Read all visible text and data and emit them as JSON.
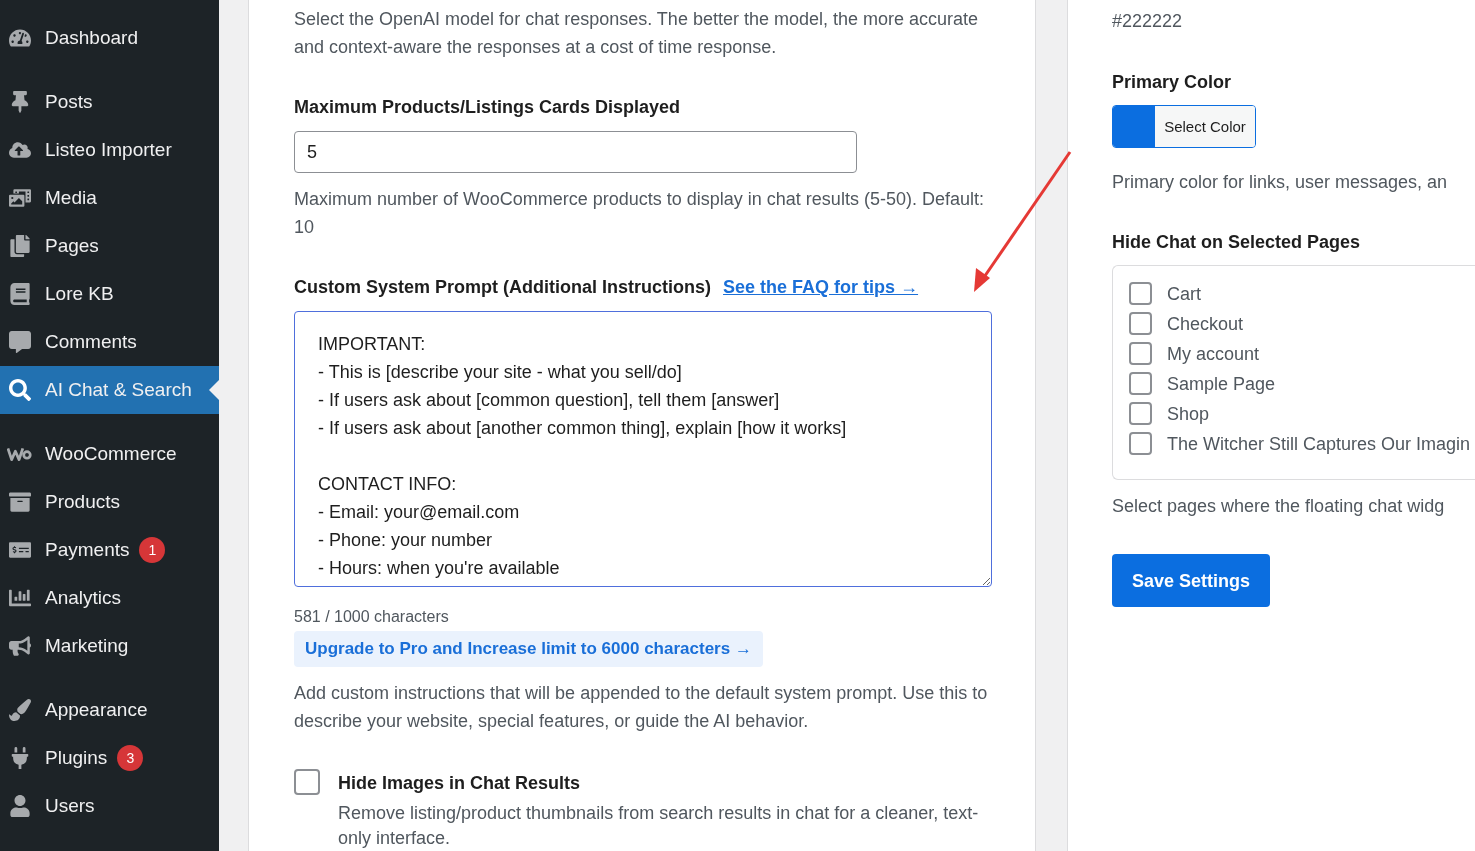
{
  "sidebar": {
    "groups": [
      [
        {
          "label": "Dashboard",
          "selected": false
        }
      ],
      [
        {
          "label": "Posts",
          "selected": false
        },
        {
          "label": "Listeo Importer",
          "selected": false
        },
        {
          "label": "Media",
          "selected": false
        },
        {
          "label": "Pages",
          "selected": false
        },
        {
          "label": "Lore KB",
          "selected": false
        },
        {
          "label": "Comments",
          "selected": false
        },
        {
          "label": "AI Chat & Search",
          "selected": true
        }
      ],
      [
        {
          "label": "WooCommerce",
          "selected": false
        },
        {
          "label": "Products",
          "selected": false
        },
        {
          "label": "Payments",
          "selected": false,
          "badge": "1"
        },
        {
          "label": "Analytics",
          "selected": false
        },
        {
          "label": "Marketing",
          "selected": false
        }
      ],
      [
        {
          "label": "Appearance",
          "selected": false
        },
        {
          "label": "Plugins",
          "selected": false,
          "badge": "3"
        },
        {
          "label": "Users",
          "selected": false
        }
      ]
    ]
  },
  "main": {
    "model_description": "Select the OpenAI model for chat responses. The better the model, the more accurate and context-aware the responses at a cost of time response.",
    "max_cards": {
      "label": "Maximum Products/Listings Cards Displayed",
      "value": "5",
      "help": "Maximum number of WooCommerce products to display in chat results (5-50). Default: 10"
    },
    "custom_prompt": {
      "label": "Custom System Prompt (Additional Instructions)",
      "link": "See the FAQ for tips →",
      "value": "IMPORTANT:\n- This is [describe your site - what you sell/do]\n- If users ask about [common question], tell them [answer]\n- If users ask about [another common thing], explain [how it works]\n\nCONTACT INFO:\n- Email: your@email.com\n- Phone: your number\n- Hours: when you're available",
      "counter": "581 / 1000 characters",
      "upgrade": "Upgrade to Pro and Increase limit to 6000 characters →",
      "help": "Add custom instructions that will be appended to the default system prompt. Use this to describe your website, special features, or guide the AI behavior."
    },
    "hide_images": {
      "label": "Hide Images in Chat Results",
      "checked": false,
      "help": "Remove listing/product thumbnails from search results in chat for a cleaner, text-only interface."
    }
  },
  "side": {
    "color_value": "#222222",
    "primary_color": {
      "label": "Primary Color",
      "color": "#0b6ee0",
      "button": "Select Color",
      "help": "Primary color for links, user messages, an"
    },
    "hide_chat": {
      "label": "Hide Chat on Selected Pages",
      "pages": [
        {
          "label": "Cart",
          "checked": false
        },
        {
          "label": "Checkout",
          "checked": false
        },
        {
          "label": "My account",
          "checked": false
        },
        {
          "label": "Sample Page",
          "checked": false
        },
        {
          "label": "Shop",
          "checked": false
        },
        {
          "label": "The Witcher Still Captures Our Imagin",
          "checked": false
        }
      ],
      "help": "Select pages where the floating chat widg"
    },
    "save": "Save Settings"
  }
}
